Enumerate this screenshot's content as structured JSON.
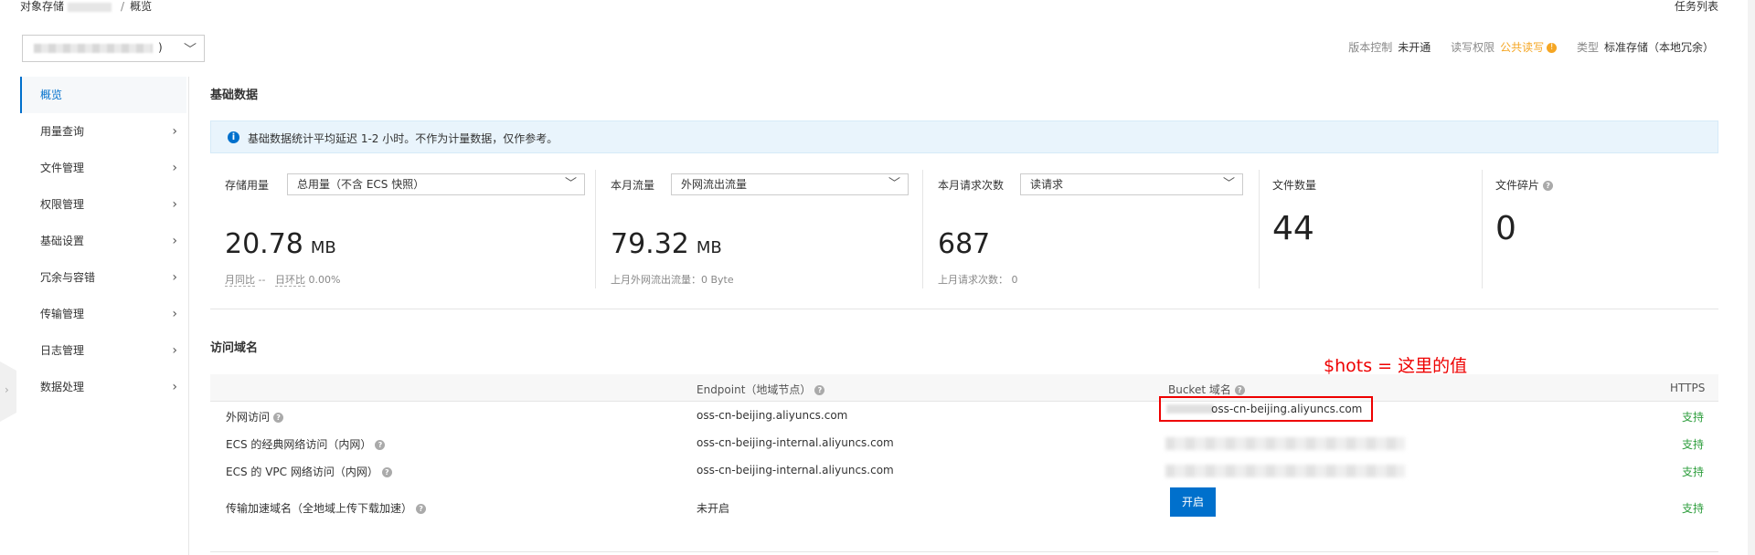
{
  "breadcrumb": {
    "root": "对象存储",
    "sep": "/",
    "current": "概览"
  },
  "task_list": "任务列表",
  "bucket_selector": {
    "suffix": ")"
  },
  "meta": {
    "version_label": "版本控制",
    "version_value": "未开通",
    "acl_label": "读写权限",
    "acl_value": "公共读写",
    "acl_warn": "!",
    "type_label": "类型",
    "type_value": "标准存储（本地冗余）"
  },
  "sidebar": {
    "items": [
      {
        "label": "概览"
      },
      {
        "label": "用量查询"
      },
      {
        "label": "文件管理"
      },
      {
        "label": "权限管理"
      },
      {
        "label": "基础设置"
      },
      {
        "label": "冗余与容错"
      },
      {
        "label": "传输管理"
      },
      {
        "label": "日志管理"
      },
      {
        "label": "数据处理"
      }
    ]
  },
  "basic": {
    "title": "基础数据",
    "info": "基础数据统计平均延迟 1-2 小时。不作为计量数据，仅作参考。",
    "storage": {
      "label": "存储用量",
      "select": "总用量（不含 ECS 快照）",
      "value": "20.78",
      "unit": "MB",
      "sub_mom": "月同比",
      "sub_mom_val": "--",
      "sub_dod": "日环比",
      "sub_dod_val": "0.00%"
    },
    "traffic": {
      "label": "本月流量",
      "select": "外网流出流量",
      "value": "79.32",
      "unit": "MB",
      "sub": "上月外网流出流量：0 Byte"
    },
    "requests": {
      "label": "本月请求次数",
      "select": "读请求",
      "value": "687",
      "sub": "上月请求次数：  0"
    },
    "files": {
      "label": "文件数量",
      "value": "44"
    },
    "fragments": {
      "label": "文件碎片",
      "value": "0"
    }
  },
  "domains": {
    "title": "访问域名",
    "headers": {
      "endpoint": "Endpoint（地域节点）",
      "bucket": "Bucket 域名",
      "https": "HTTPS"
    },
    "rows": [
      {
        "name": "外网访问",
        "endpoint": "oss-cn-beijing.aliyuncs.com",
        "bucket": "oss-cn-beijing.aliyuncs.com",
        "https": "支持"
      },
      {
        "name": "ECS 的经典网络访问（内网）",
        "endpoint": "oss-cn-beijing-internal.aliyuncs.com",
        "https": "支持"
      },
      {
        "name": "ECS 的 VPC 网络访问（内网）",
        "endpoint": "oss-cn-beijing-internal.aliyuncs.com",
        "https": "支持"
      },
      {
        "name": "传输加速域名（全地域上传下载加速）",
        "endpoint": "未开启",
        "button": "开启",
        "https": "支持"
      }
    ]
  },
  "annotation": "$hots = 这里的值",
  "icons": {
    "chevron": "chevron-right-icon",
    "help": "?",
    "info": "i"
  }
}
